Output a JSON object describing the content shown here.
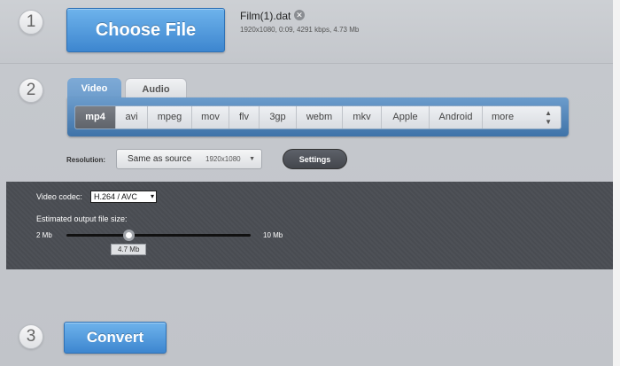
{
  "steps": {
    "one": "1",
    "two": "2",
    "three": "3"
  },
  "file": {
    "choose_label": "Choose File",
    "name": "Film(1).dat",
    "meta": "1920x1080, 0:09, 4291 kbps, 4.73 Mb",
    "remove_glyph": "✕"
  },
  "tabs": [
    {
      "label": "Video",
      "active": true
    },
    {
      "label": "Audio",
      "active": false
    }
  ],
  "formats": [
    {
      "label": "mp4",
      "active": true
    },
    {
      "label": "avi"
    },
    {
      "label": "mpeg"
    },
    {
      "label": "mov"
    },
    {
      "label": "flv"
    },
    {
      "label": "3gp"
    },
    {
      "label": "webm"
    },
    {
      "label": "mkv"
    },
    {
      "label": "Apple"
    },
    {
      "label": "Android"
    },
    {
      "label": "more"
    }
  ],
  "resolution": {
    "label": "Resolution:",
    "value": "Same as source",
    "dimensions": "1920x1080",
    "caret": "▼"
  },
  "settings_label": "Settings",
  "codec": {
    "label": "Video codec:",
    "value": "H.264 / AVC",
    "caret": "▾"
  },
  "output_size": {
    "label": "Estimated output file size:",
    "min_label": "2 Mb",
    "max_label": "10 Mb",
    "value_label": "4.7 Mb",
    "min": 2,
    "max": 10,
    "value": 4.7
  },
  "convert_label": "Convert",
  "colors": {
    "accent": "#3d86cf",
    "panel": "#4a4d53",
    "format_panel": "#3f73a8"
  }
}
